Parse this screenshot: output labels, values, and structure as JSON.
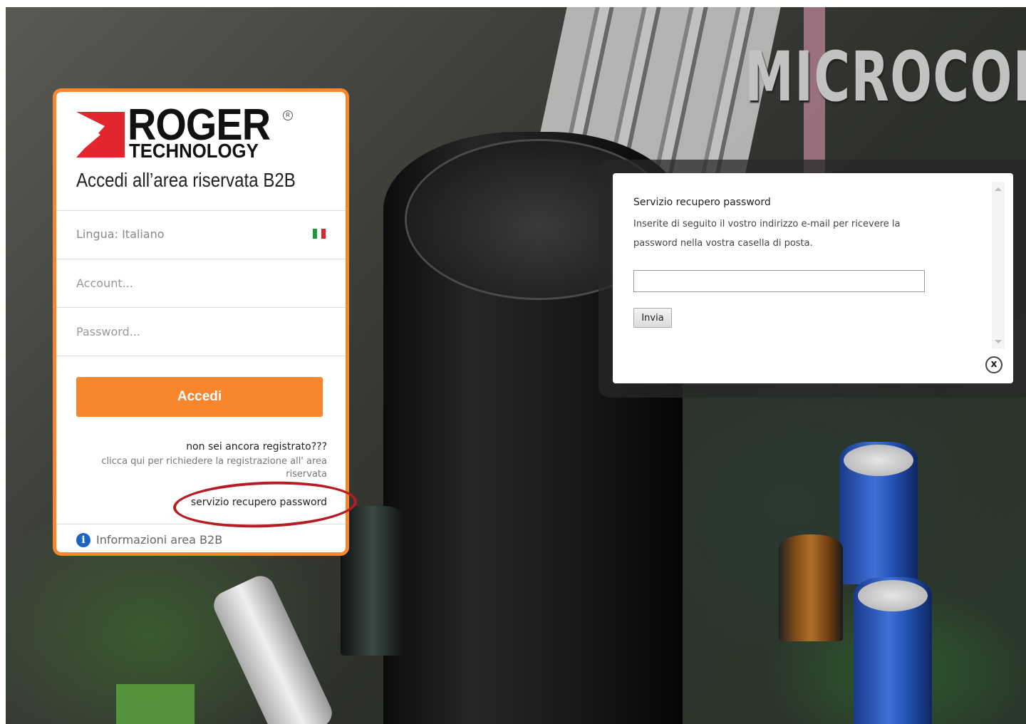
{
  "background": {
    "brand_text": "MICROCON"
  },
  "login": {
    "logo": {
      "word1": "ROGER",
      "word2": "TECHNOLOGY",
      "registered_mark": "R",
      "accent_color": "#e3262e"
    },
    "title": "Accedi all’area riservata B2B",
    "language_label": "Lingua: Italiano",
    "language_flag": "flag-it-icon",
    "account_placeholder": "Account...",
    "password_placeholder": "Password...",
    "submit_label": "Accedi",
    "register_question": "non sei ancora registrato???",
    "register_hint": "clicca qui per richiedere la registrazione all' area riservata",
    "password_recovery_link": "servizio recupero password",
    "info_icon": "info-icon",
    "info_label": "Informazioni area B2B",
    "accent_color": "#f7862d"
  },
  "annotation": {
    "ellipse_color": "#b71c24"
  },
  "modal": {
    "title": "Servizio recupero password",
    "description": "Inserite di seguito il vostro indirizzo e-mail per ricevere la password nella vostra casella di posta.",
    "email_value": "",
    "submit_label": "Invia",
    "close_icon": "close-icon",
    "close_symbol": "x"
  }
}
